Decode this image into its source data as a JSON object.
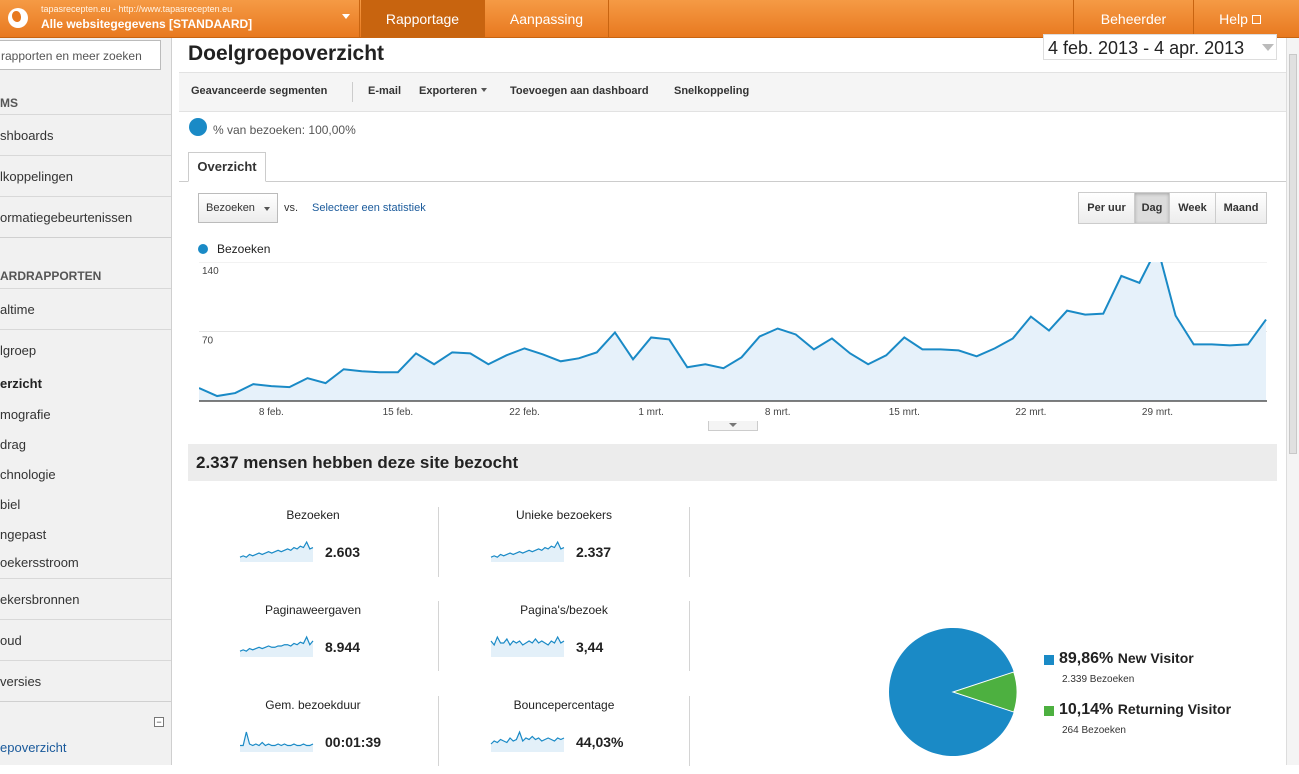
{
  "topbar": {
    "account_url": "tapasrecepten.eu - http://www.tapasrecepten.eu",
    "account_name": "Alle websitegegevens [STANDAARD]",
    "tabs": [
      "Rapportage",
      "Aanpassing"
    ],
    "active_tab": "Rapportage",
    "right_links": [
      "Beheerder",
      "Help"
    ],
    "accent": "#e8791f"
  },
  "sidebar": {
    "search_placeholder": "rapporten en meer zoeken",
    "section_items": "MS",
    "items_top": [
      "shboards",
      "lkoppelingen",
      "ormatiegebeurtenissen"
    ],
    "section_standard": "ARDRAPPORTEN",
    "realtime": "altime",
    "audience": "lgroep",
    "audience_sub": [
      "erzicht",
      "mografie",
      "drag",
      "chnologie",
      "biel",
      "ngepast",
      "oekersstroom"
    ],
    "items_bottom": [
      "ekersbronnen",
      "oud",
      "versies"
    ],
    "footer_link": "epoverzicht"
  },
  "header": {
    "title": "Doelgroepoverzicht",
    "date_range": "4 feb. 2013 - 4 apr. 2013"
  },
  "toolbar": {
    "advanced_segments": "Geavanceerde segmenten",
    "email": "E-mail",
    "export": "Exporteren",
    "add_dashboard": "Toevoegen aan dashboard",
    "shortcut": "Snelkoppeling"
  },
  "segment": {
    "label": "% van bezoeken: 100,00%"
  },
  "tabs": {
    "overview": "Overzicht"
  },
  "chart_controls": {
    "metric": "Bezoeken",
    "vs": "vs.",
    "select_stat": "Selecteer een statistiek",
    "periods": [
      "Per uur",
      "Dag",
      "Week",
      "Maand"
    ],
    "active_period": "Dag"
  },
  "chart_data": {
    "type": "area",
    "series": [
      {
        "name": "Bezoeken",
        "values": [
          13,
          5,
          8,
          17,
          15,
          14,
          23,
          18,
          32,
          30,
          29,
          29,
          48,
          37,
          49,
          48,
          37,
          46,
          53,
          47,
          40,
          43,
          49,
          69,
          42,
          64,
          62,
          34,
          37,
          33,
          44,
          65,
          73,
          67,
          52,
          63,
          48,
          37,
          46,
          64,
          52,
          52,
          51,
          45,
          53,
          63,
          85,
          71,
          91,
          87,
          88,
          126,
          119,
          155,
          86,
          57,
          57,
          56,
          57,
          82
        ],
        "color": "#1a8ac6"
      }
    ],
    "x_tick_labels": [
      "8 feb.",
      "15 feb.",
      "22 feb.",
      "1 mrt.",
      "8 mrt.",
      "15 mrt.",
      "22 mrt.",
      "29 mrt."
    ],
    "y_tick_labels": [
      "70",
      "140"
    ],
    "ylim": [
      0,
      140
    ],
    "legend": "top-left",
    "grid": true
  },
  "summary": {
    "headline": "2.337 mensen hebben deze site bezocht",
    "metrics": [
      {
        "label": "Bezoeken",
        "value": "2.603",
        "spark": [
          2,
          3,
          2,
          4,
          3,
          4,
          5,
          4,
          5,
          6,
          5,
          6,
          7,
          6,
          7,
          8,
          7,
          9,
          8,
          10,
          9,
          13,
          8,
          9
        ]
      },
      {
        "label": "Unieke bezoekers",
        "value": "2.337",
        "spark": [
          2,
          3,
          2,
          4,
          3,
          4,
          5,
          4,
          5,
          6,
          5,
          6,
          7,
          6,
          7,
          8,
          7,
          9,
          8,
          10,
          9,
          13,
          8,
          9
        ]
      },
      {
        "label": "Paginaweergaven",
        "value": "8.944",
        "spark": [
          3,
          4,
          3,
          5,
          4,
          5,
          6,
          5,
          6,
          7,
          6,
          6,
          7,
          7,
          8,
          8,
          7,
          9,
          8,
          10,
          9,
          14,
          8,
          11
        ]
      },
      {
        "label": "Pagina's/bezoek",
        "value": "3,44",
        "spark": [
          7,
          5,
          9,
          6,
          6,
          8,
          5,
          7,
          6,
          7,
          5,
          6,
          7,
          6,
          8,
          6,
          7,
          6,
          5,
          7,
          6,
          9,
          6,
          7
        ]
      },
      {
        "label": "Gem. bezoekduur",
        "value": "00:01:39",
        "spark": [
          3,
          3,
          12,
          4,
          3,
          4,
          3,
          5,
          3,
          4,
          3,
          3,
          4,
          3,
          4,
          3,
          3,
          4,
          3,
          3,
          4,
          3,
          3,
          4
        ]
      },
      {
        "label": "Bouncepercentage",
        "value": "44,03%",
        "spark": [
          4,
          6,
          5,
          7,
          6,
          5,
          8,
          6,
          7,
          12,
          6,
          8,
          7,
          9,
          7,
          8,
          6,
          7,
          8,
          7,
          6,
          8,
          7,
          8
        ]
      }
    ]
  },
  "visitor_pie": {
    "segments": [
      {
        "pct": "89,86%",
        "name": "New Visitor",
        "sub": "2.339 Bezoeken",
        "value": 89.86,
        "color": "#1a8ac6"
      },
      {
        "pct": "10,14%",
        "name": "Returning Visitor",
        "sub": "264 Bezoeken",
        "value": 10.14,
        "color": "#4db040"
      }
    ]
  }
}
